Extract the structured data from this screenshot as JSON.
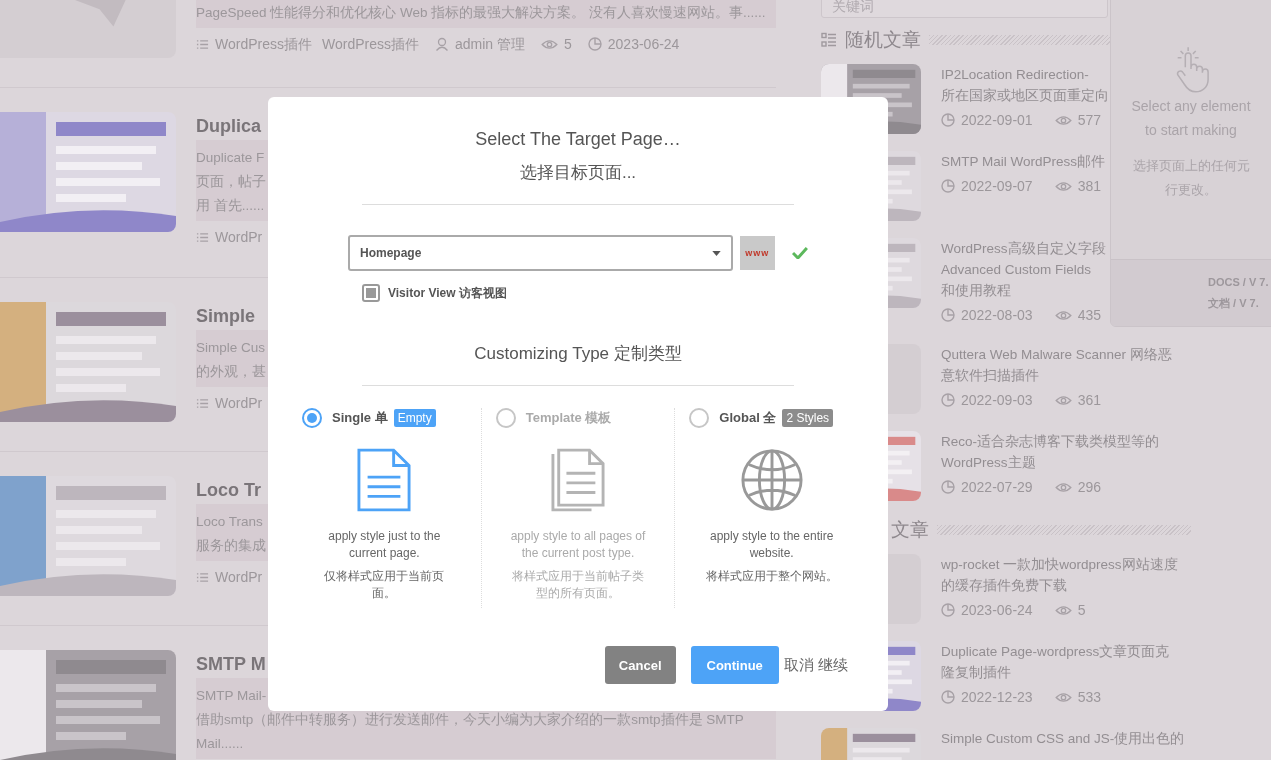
{
  "articles": [
    {
      "kind": "placeholder",
      "excerpt": [
        "PageSpeed 性能得分和优化核心 Web 指标的最强大解决方案。 没有人喜欢慢速网站。事......"
      ],
      "meta": {
        "categories": [
          "WordPress插件",
          "WordPress插件"
        ],
        "author": "admin 管理",
        "views": "5",
        "date": "2023-06-24"
      }
    },
    {
      "kind": "picture",
      "title": "Duplica",
      "excerpt": [
        "Duplicate F",
        "页面，帖子",
        "用 首先......"
      ],
      "meta": {
        "categories": [
          "WordPr"
        ]
      }
    },
    {
      "kind": "picture",
      "title": "Simple",
      "excerpt": [
        "Simple Cus",
        "的外观，甚"
      ],
      "meta": {
        "categories": [
          "WordPr"
        ]
      }
    },
    {
      "kind": "picture",
      "title": "Loco Tr",
      "excerpt": [
        "Loco Trans",
        "服务的集成"
      ],
      "meta": {
        "categories": [
          "WordPr"
        ]
      }
    },
    {
      "kind": "picture",
      "title": "SMTP M",
      "excerpt": [
        "SMTP Mail-",
        "借助smtp（邮件中转服务）进行发送邮件，今天小编为大家介绍的一款smtp插件是 SMTP",
        "Mail......"
      ]
    }
  ],
  "sidebar": {
    "search": {
      "placeholder": "关键词"
    },
    "sections": [
      {
        "title": "随机文章",
        "icon": true,
        "items": [
          {
            "kind": "picture",
            "title": [
              "IP2Location Redirection-",
              "所在国家或地区页面重定向"
            ],
            "date": "2022-09-01",
            "views": "577"
          },
          {
            "kind": "picture",
            "title": [
              "SMTP Mail WordPress邮件"
            ],
            "date": "2022-09-07",
            "views": "381"
          },
          {
            "kind": "picture",
            "title": [
              "WordPress高级自定义字段",
              "Advanced Custom Fields",
              "和使用教程"
            ],
            "date": "2022-08-03",
            "views": "435"
          },
          {
            "kind": "placeholder",
            "title": [
              "Quttera Web Malware Scanner 网络恶",
              "意软件扫描插件"
            ],
            "date": "2022-09-03",
            "views": "361"
          },
          {
            "kind": "picture",
            "title": [
              "Reco-适合杂志博客下载类模型等的",
              "WordPress主题"
            ],
            "date": "2022-07-29",
            "views": "296"
          }
        ]
      },
      {
        "title": "文章",
        "icon": false,
        "items": [
          {
            "kind": "placeholder",
            "title": [
              "wp-rocket 一款加快wordpress网站速度",
              "的缓存插件免费下载"
            ],
            "date": "2023-06-24",
            "views": "5"
          },
          {
            "kind": "picture",
            "title": [
              "Duplicate Page-wordpress文章页面克",
              "隆复制插件"
            ],
            "date": "2022-12-23",
            "views": "533"
          },
          {
            "kind": "picture",
            "title": [
              "Simple Custom CSS and JS-使用出色的"
            ]
          }
        ]
      }
    ]
  },
  "editor_panel": {
    "hint_en": [
      "Select any element",
      "to start making"
    ],
    "hint_zh": [
      "选择页面上的任何元",
      "行更改。"
    ],
    "footer": [
      "DOCS / V 7.",
      "文档 / V 7."
    ]
  },
  "dialog": {
    "title": "Select The Target Page…",
    "subtitle": "选择目标页面...",
    "page_select": {
      "value": "Homepage"
    },
    "preview_badge": "www",
    "valid": true,
    "visitor_view": {
      "label": "Visitor View 访客视图",
      "checked": true
    },
    "type_heading": "Customizing Type 定制类型",
    "options": [
      {
        "kind": "document",
        "label": "Single 单",
        "badge": "Empty",
        "color": "#4da3f7",
        "selected": true,
        "disabled": false,
        "description": "apply style just to the current page.",
        "description_zh": "仅将样式应用于当前页面。"
      },
      {
        "kind": "documents",
        "label": "Template 模板",
        "selected": false,
        "disabled": true,
        "description": "apply style to all pages of the current post type.",
        "description_zh": "将样式应用于当前帖子类型的所有页面。"
      },
      {
        "kind": "globe",
        "label": "Global 全",
        "badge": "2 Styles",
        "color": "#8c8c8c",
        "selected": false,
        "disabled": false,
        "description": "apply style to the entire website.",
        "description_zh": "将样式应用于整个网站。"
      }
    ],
    "buttons": [
      {
        "kind": "secondary",
        "label": "Cancel"
      },
      {
        "kind": "primary",
        "label": "Continue"
      }
    ],
    "footer_note": "取消 继续"
  }
}
